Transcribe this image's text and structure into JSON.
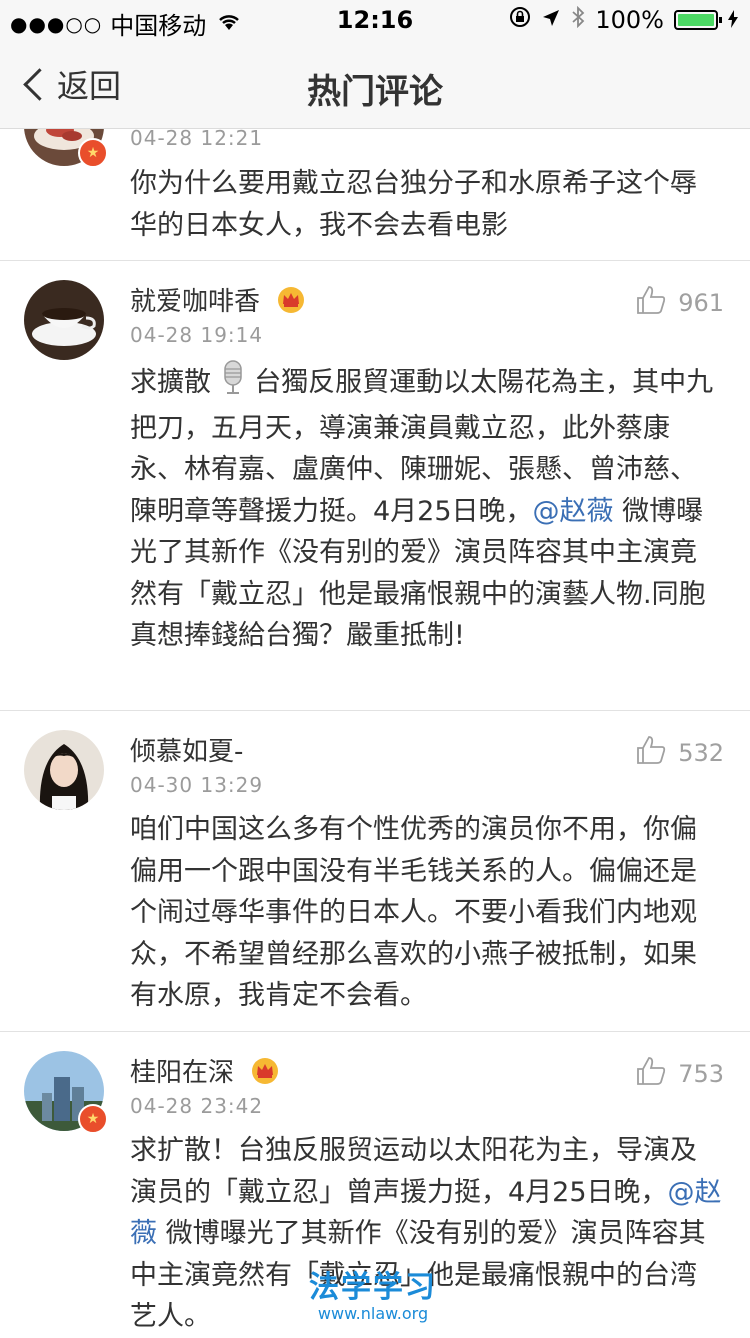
{
  "status_bar": {
    "signal": "●●●○○",
    "carrier": "中国移动",
    "time": "12:16",
    "battery": "100%"
  },
  "nav": {
    "back_label": "返回",
    "title": "热门评论"
  },
  "comments": [
    {
      "username": "",
      "time": "04-28 12:21",
      "likes": "",
      "text": "你为什么要用戴立忍台独分子和水原希子这个辱华的日本女人，我不会去看电影"
    },
    {
      "username": "就爱咖啡香",
      "time": "04-28 19:14",
      "likes": "961",
      "text_a": "求擴散",
      "text_b": "台獨反服貿運動以太陽花為主，其中九把刀，五月天，導演兼演員戴立忍，此外蔡康永、林宥嘉、盧廣仲、陳珊妮、張懸、曾沛慈、陳明章等聲援力挺。4月25日晚，",
      "mention": "@赵薇",
      "text_c": " 微博曝光了其新作《没有别的爱》演员阵容其中主演竟然有「戴立忍」他是最痛恨親中的演藝人物.同胞真想捧錢給台獨？嚴重抵制!"
    },
    {
      "username": "倾慕如夏-",
      "time": "04-30 13:29",
      "likes": "532",
      "text": "咱们中国这么多有个性优秀的演员你不用，你偏偏用一个跟中国没有半毛钱关系的人。偏偏还是个闹过辱华事件的日本人。不要小看我们内地观众，不希望曾经那么喜欢的小燕子被抵制，如果有水原，我肯定不会看。"
    },
    {
      "username": "桂阳在深",
      "time": "04-28 23:42",
      "likes": "753",
      "text_a": "求扩散！台独反服贸运动以太阳花为主，导演及演员的「戴立忍」曾声援力挺，4月25日晚，",
      "mention": "@赵薇",
      "text_b": " 微博曝光了其新作《没有别的爱》演员阵容其中主演竟然有「戴立忍」他是最痛恨親中的台湾艺人。"
    }
  ],
  "watermark": {
    "title": "法学学习",
    "url": "www.nlaw.org"
  }
}
